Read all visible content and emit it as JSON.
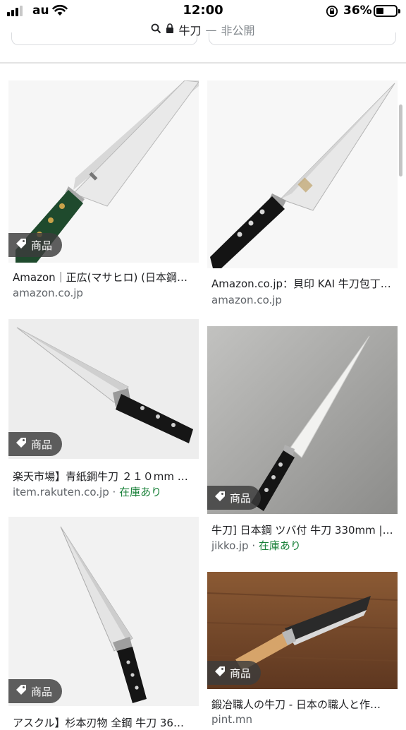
{
  "status": {
    "carrier": "au",
    "time": "12:00",
    "battery": "36%"
  },
  "address": {
    "query": "牛刀",
    "separator": "—",
    "mode": "非公開"
  },
  "results": [
    {
      "title": "Amazon｜正広(マサヒロ) (日本鋼…",
      "source": "amazon.co.jp",
      "stock": "",
      "badge": "商品"
    },
    {
      "title": "Amazon.co.jp：貝印 KAI 牛刀包丁…",
      "source": "amazon.co.jp",
      "stock": "",
      "badge": ""
    },
    {
      "title": "楽天市場】青紙鋼牛刀 ２１０mm …",
      "source": "item.rakuten.co.jp",
      "stock": "在庫あり",
      "badge": "商品"
    },
    {
      "title": "牛刀] 日本鋼 ツバ付 牛刀 330mm |…",
      "source": "jikko.jp",
      "stock": "在庫あり",
      "badge": "商品"
    },
    {
      "title": "アスクル】杉本刃物 全鋼 牛刀 36…",
      "source": "",
      "stock": "",
      "badge": "商品"
    },
    {
      "title": "鍛冶職人の牛刀 - 日本の職人と作…",
      "source": "pint.mn",
      "stock": "",
      "badge": "商品"
    }
  ],
  "separator_dot": "·",
  "colors": {
    "text": "#202124",
    "source": "#5f6368",
    "in_stock": "#188038",
    "badge_bg": "#3c3c3c"
  }
}
